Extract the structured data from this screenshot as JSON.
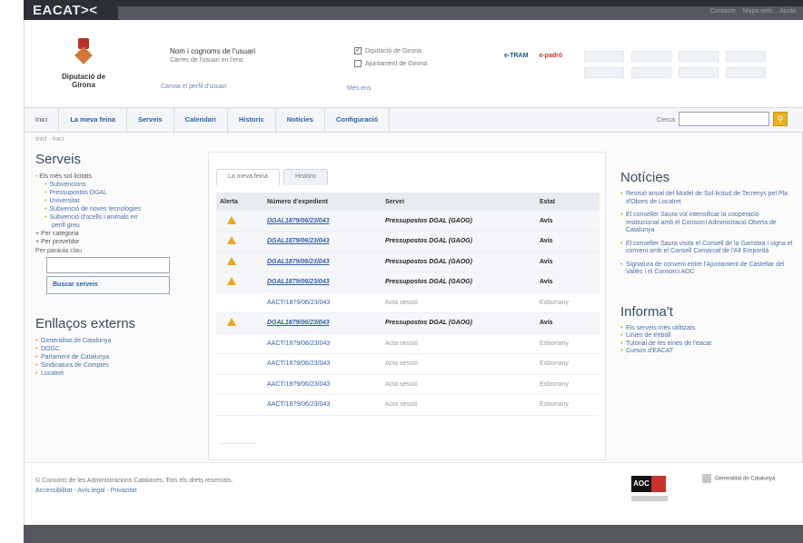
{
  "brand": "EACAT><",
  "topbar_links": [
    "Contacte",
    "Mapa web",
    "Ajuda"
  ],
  "header": {
    "org_name": "Diputació de Girona",
    "user_name": "Nom i cognoms de l'usuari",
    "user_role": "Càrrec de l'usuari en l'ens",
    "change_user": "Canvia el perfil d'usuari",
    "entities": [
      {
        "label": "Diputació de Girona",
        "checked": true
      },
      {
        "label": "Ajuntament de Girona",
        "checked": false
      }
    ],
    "entities_more": "Més ens",
    "etram": "e-TRAM",
    "padro": "e-padró"
  },
  "nav": {
    "items": [
      "Inici",
      "La meva feina",
      "Serveis",
      "Calendari",
      "Historic",
      "Notícies",
      "Configuració"
    ],
    "search_label": "Cerca",
    "search_icon": "search-icon"
  },
  "breadcrumb": "Inici · Inici",
  "serveis": {
    "title": "Serveis",
    "head": "- Els més sol·licitats",
    "items": [
      "Subvencions",
      "Pressupostos DGAL",
      "Universitat",
      "Subvenció de noves tecnologies",
      "Subvenció d'ocells i animals en",
      "perill greu"
    ],
    "by_category": "+ Per categoria",
    "by_provider": "+ Per proveïdor",
    "keyword_label": "Per paraula clau",
    "search_button": "Buscar serveis"
  },
  "external": {
    "title": "Enllaços externs",
    "items": [
      "Generalitat de Catalunya",
      "DOGC",
      "Parlament de Catalunya",
      "Sindicatura de Comptes",
      "Localret"
    ]
  },
  "main": {
    "tabs": [
      "La meva feina",
      "Històric"
    ],
    "columns": [
      "Alerta",
      "Número d'expedient",
      "Servei",
      "Estat"
    ],
    "rows": [
      {
        "alert": true,
        "exp": "DGAL1879/06/23/043",
        "service": "Pressupostos DGAL (GAOG)",
        "state": "Avís"
      },
      {
        "alert": true,
        "exp": "DGAL1879/06/23/043",
        "service": "Pressupostos DGAL (GAOG)",
        "state": "Avís"
      },
      {
        "alert": true,
        "exp": "DGAL1879/06/23/043",
        "service": "Pressupostos DGAL (GAOG)",
        "state": "Avís"
      },
      {
        "alert": true,
        "exp": "DGAL1879/06/23/043",
        "service": "Pressupostos DGAL (GAOG)",
        "state": "Avís"
      },
      {
        "alert": false,
        "exp": "AACT/1879/06/23/043",
        "service": "Acta sessió",
        "state": "Esborrany"
      },
      {
        "alert": true,
        "exp": "DGAL1879/06/23/043",
        "service": "Pressupostos DGAL (GAOG)",
        "state": "Avís"
      },
      {
        "alert": false,
        "exp": "AACT/1879/06/23/043",
        "service": "Acta sessió",
        "state": "Esborrany"
      },
      {
        "alert": false,
        "exp": "AACT/1879/06/23/043",
        "service": "Acta sessió",
        "state": "Esborrany"
      },
      {
        "alert": false,
        "exp": "AACT/1879/06/23/043",
        "service": "Acta sessió",
        "state": "Esborrany"
      },
      {
        "alert": false,
        "exp": "AACT/1879/06/23/043",
        "service": "Acta sessió",
        "state": "Esborrany"
      }
    ]
  },
  "noticies": {
    "title": "Notícies",
    "items": [
      "Revisió anual del Model de Sol·licitud de Terrenys pel Pla d'Obres de Localret",
      "El conseller Saura vol intensificar la cooperació institucional amb el Consorci Administració Oberta de Catalunya",
      "El conseller Saura visita el Consell de la Garrotxa i signa el conveni amb el Consell Comarcal de l'Alt Empordà",
      "Signatura de conveni entre l'Ajuntament de Castellar del Vallès i el Consorci AOC"
    ]
  },
  "informat": {
    "title": "Informa't",
    "items": [
      "Els serveis més utilitzats",
      "Línies de treball",
      "Tutorial de les eines de l'eacat",
      "Cursos d'EACAT"
    ]
  },
  "footer": {
    "copyright": "© Consorci de les Administracions Catalanes. Tots els drets reservats.",
    "links": "Accessibilitat - Avís legal - Privacitat",
    "aoc": "AOC",
    "gencat": "Generalitat de Catalunya"
  }
}
